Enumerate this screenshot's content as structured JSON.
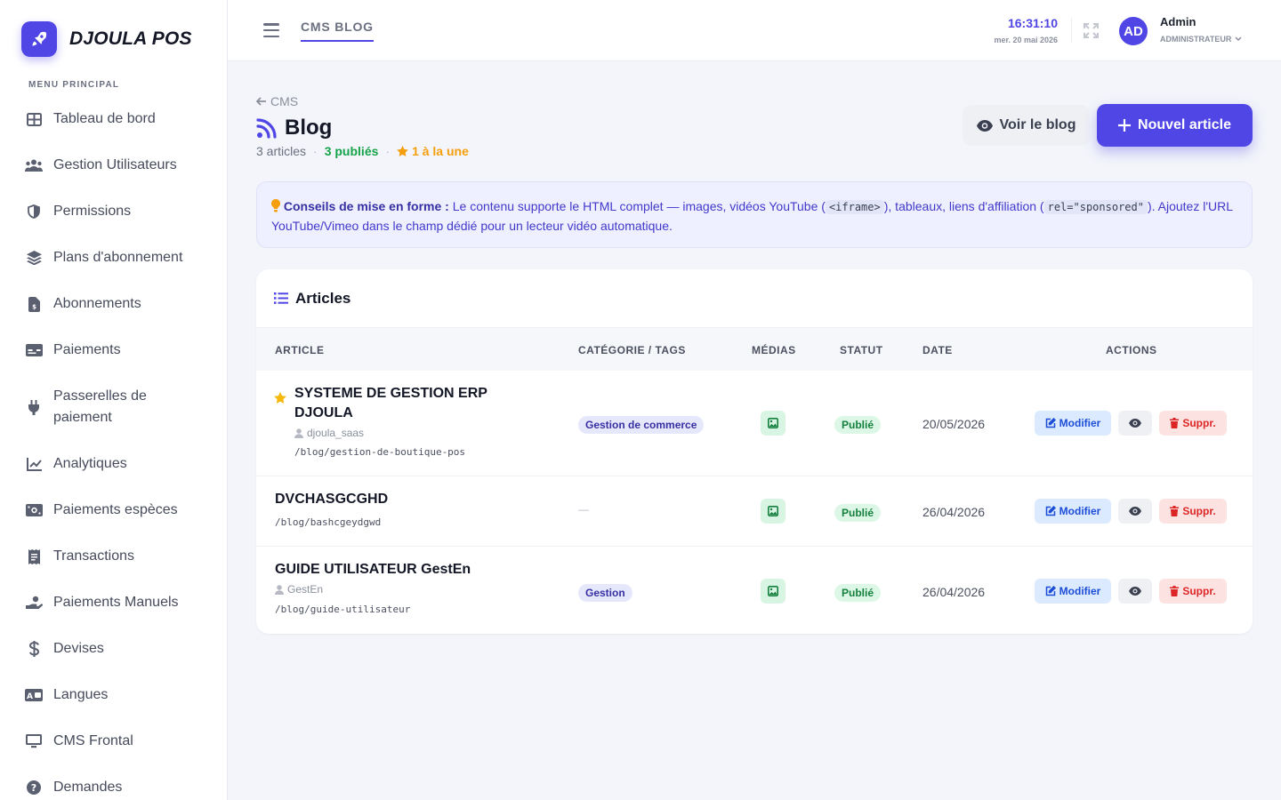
{
  "brand": {
    "name": "DJOULA POS",
    "icon": "rocket-icon"
  },
  "sidebar": {
    "section_label": "MENU PRINCIPAL",
    "items": [
      {
        "label": "Tableau de bord",
        "icon": "dashboard-grid-icon"
      },
      {
        "label": "Gestion Utilisateurs",
        "icon": "users-icon"
      },
      {
        "label": "Permissions",
        "icon": "shield-icon"
      },
      {
        "label": "Plans d'abonnement",
        "icon": "layers-icon"
      },
      {
        "label": "Abonnements",
        "icon": "invoice-icon"
      },
      {
        "label": "Paiements",
        "icon": "credit-card-icon"
      },
      {
        "label": "Passerelles de paiement",
        "icon": "plug-icon"
      },
      {
        "label": "Analytiques",
        "icon": "chart-line-icon"
      },
      {
        "label": "Paiements espèces",
        "icon": "cash-icon"
      },
      {
        "label": "Transactions",
        "icon": "receipt-icon"
      },
      {
        "label": "Paiements Manuels",
        "icon": "hand-coin-icon"
      },
      {
        "label": "Devises",
        "icon": "dollar-icon"
      },
      {
        "label": "Langues",
        "icon": "language-icon"
      },
      {
        "label": "CMS Frontal",
        "icon": "monitor-icon"
      },
      {
        "label": "Demandes",
        "icon": "question-icon"
      }
    ]
  },
  "topbar": {
    "tab_label": "CMS BLOG",
    "clock_time": "16:31:10",
    "clock_date": "mer. 20 mai 2026",
    "avatar_initials": "AD",
    "user_name": "Admin",
    "user_role": "ADMINISTRATEUR"
  },
  "page": {
    "back_label": "CMS",
    "title": "Blog",
    "stat_articles": "3 articles",
    "stat_published": "3 publiés",
    "stat_featured": "1 à la une",
    "view_button": "Voir le blog",
    "new_button": "Nouvel article"
  },
  "tip": {
    "strong": "Conseils de mise en forme :",
    "text1": " Le contenu supporte le HTML complet — images, vidéos YouTube (",
    "code1": "<iframe>",
    "text2": "), tableaux, liens d'affiliation (",
    "code2": "rel=\"sponsored\"",
    "text3": "). Ajoutez l'URL YouTube/Vimeo dans le champ dédié pour un lecteur vidéo automatique."
  },
  "articles": {
    "card_title": "Articles",
    "columns": {
      "article": "ARTICLE",
      "category": "CATÉGORIE / TAGS",
      "media": "MÉDIAS",
      "status": "STATUT",
      "date": "DATE",
      "actions": "ACTIONS"
    },
    "rows": [
      {
        "title_line1": "SYSTEME DE GESTION ERP",
        "title_line2": "DJOULA",
        "author": "djoula_saas",
        "slug": "/blog/gestion-de-boutique-pos",
        "category": "Gestion de commerce",
        "status": "Publié",
        "date": "20/05/2026"
      },
      {
        "title_line1": "DVCHASGCGHD",
        "slug": "/blog/bashcgeydgwd",
        "category_empty": "—",
        "status": "Publié",
        "date": "26/04/2026"
      },
      {
        "title_line1": "GUIDE UTILISATEUR GestEn",
        "author": "GestEn",
        "slug": "/blog/guide-utilisateur",
        "category": "Gestion",
        "status": "Publié",
        "date": "26/04/2026"
      }
    ],
    "edit_label": "Modifier",
    "delete_label": "Suppr."
  },
  "colors": {
    "accent": "#4f46e5",
    "success": "#16a34a",
    "warning": "#f59e0b",
    "danger": "#dc2626"
  }
}
